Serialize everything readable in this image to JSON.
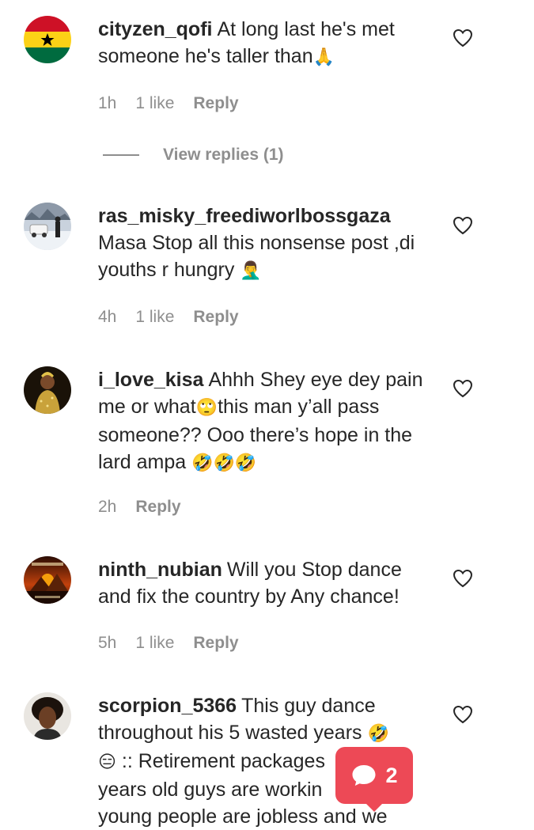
{
  "comments": [
    {
      "username": "cityzen_qofi",
      "text": "At long last he's met someone he's taller than",
      "emoji": "🙏",
      "time": "1h",
      "likes": "1 like",
      "reply": "Reply",
      "view_replies": "View replies (1)"
    },
    {
      "username": "ras_misky_freediworlbossgaza",
      "text": "Masa Stop all this nonsense post ,di youths r hungry",
      "emoji": "🤦‍♂️",
      "time": "4h",
      "likes": "1 like",
      "reply": "Reply"
    },
    {
      "username": "i_love_kisa",
      "text_a": "Ahhh Shey eye dey pain me or what",
      "emoji_a": "🙄",
      "text_b": "this man y’all pass someone?? Ooo there’s hope in the lard ampa",
      "emoji_b": "🤣🤣🤣",
      "time": "2h",
      "reply": "Reply"
    },
    {
      "username": "ninth_nubian",
      "text": "Will you Stop dance and fix the country by Any chance!",
      "time": "5h",
      "likes": "1 like",
      "reply": "Reply"
    },
    {
      "username": "scorpion_5366",
      "text_a": "This guy dance throughout his 5 wasted years",
      "emoji_a": "🤣",
      "emoji_b": "😑",
      "text_b": ":: Retirement packages",
      "text_c": "years old guys are workin",
      "text_d": "young people are jobless and we"
    }
  ],
  "notification": {
    "count": "2",
    "icon": "comment-bubble-icon",
    "color": "#ed4956"
  },
  "icons": {
    "heart": "heart-outline-icon"
  }
}
